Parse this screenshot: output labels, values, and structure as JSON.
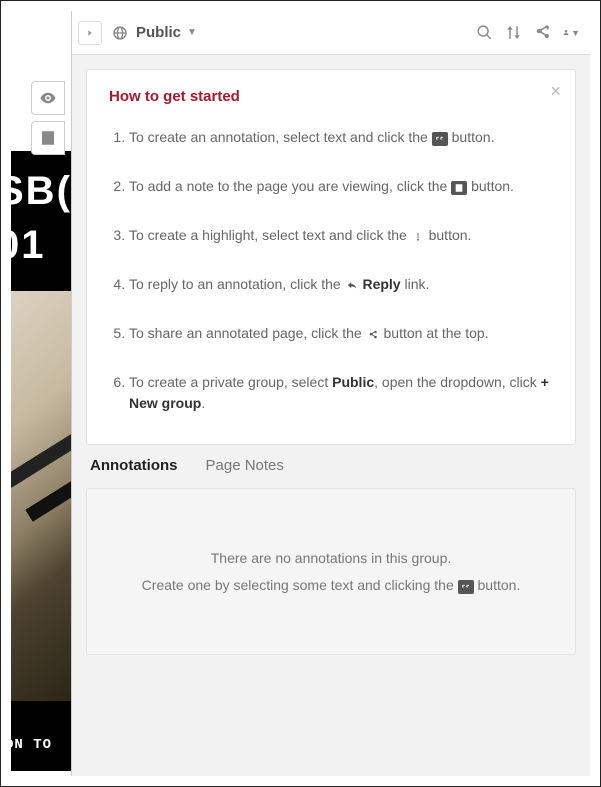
{
  "bgText": {
    "line1": "SB(",
    "line2": "01",
    "caption": "ON TO"
  },
  "sideRail": {
    "visibilityIcon": "eye-icon",
    "noteIcon": "note-icon"
  },
  "topbar": {
    "collapseIcon": "chevron-right-icon",
    "groupIcon": "globe-icon",
    "groupLabel": "Public",
    "actions": {
      "search": "search-icon",
      "sort": "sort-icon",
      "share": "share-icon",
      "user": "user-icon"
    }
  },
  "help": {
    "title": "How to get started",
    "closeLabel": "×",
    "steps": [
      {
        "pre": "To create an annotation, select text and click the ",
        "icon": "quote-icon",
        "iconBoxed": true,
        "post": " button."
      },
      {
        "pre": "To add a note to the page you are viewing, click the ",
        "icon": "note-icon",
        "iconBoxed": true,
        "post": " button."
      },
      {
        "pre": "To create a highlight, select text and click the ",
        "icon": "highlight-icon",
        "iconBoxed": false,
        "post": " button."
      },
      {
        "pre": "To reply to an annotation, click the ",
        "icon": "reply-icon",
        "iconBoxed": false,
        "bold": "Reply",
        "post": " link."
      },
      {
        "pre": "To share an annotated page, click the ",
        "icon": "share-icon",
        "iconBoxed": false,
        "post": " button at the top."
      },
      {
        "pre": "To create a private group, select ",
        "bold": "Public",
        "mid": ", open the dropdown, click ",
        "bold2": "+ New group",
        "post": "."
      }
    ]
  },
  "tabs": {
    "annotations": "Annotations",
    "pageNotes": "Page Notes",
    "selected": "annotations"
  },
  "empty": {
    "line1": "There are no annotations in this group.",
    "line2Pre": "Create one by selecting some text and clicking the ",
    "line2Icon": "quote-icon",
    "line2Post": " button."
  }
}
